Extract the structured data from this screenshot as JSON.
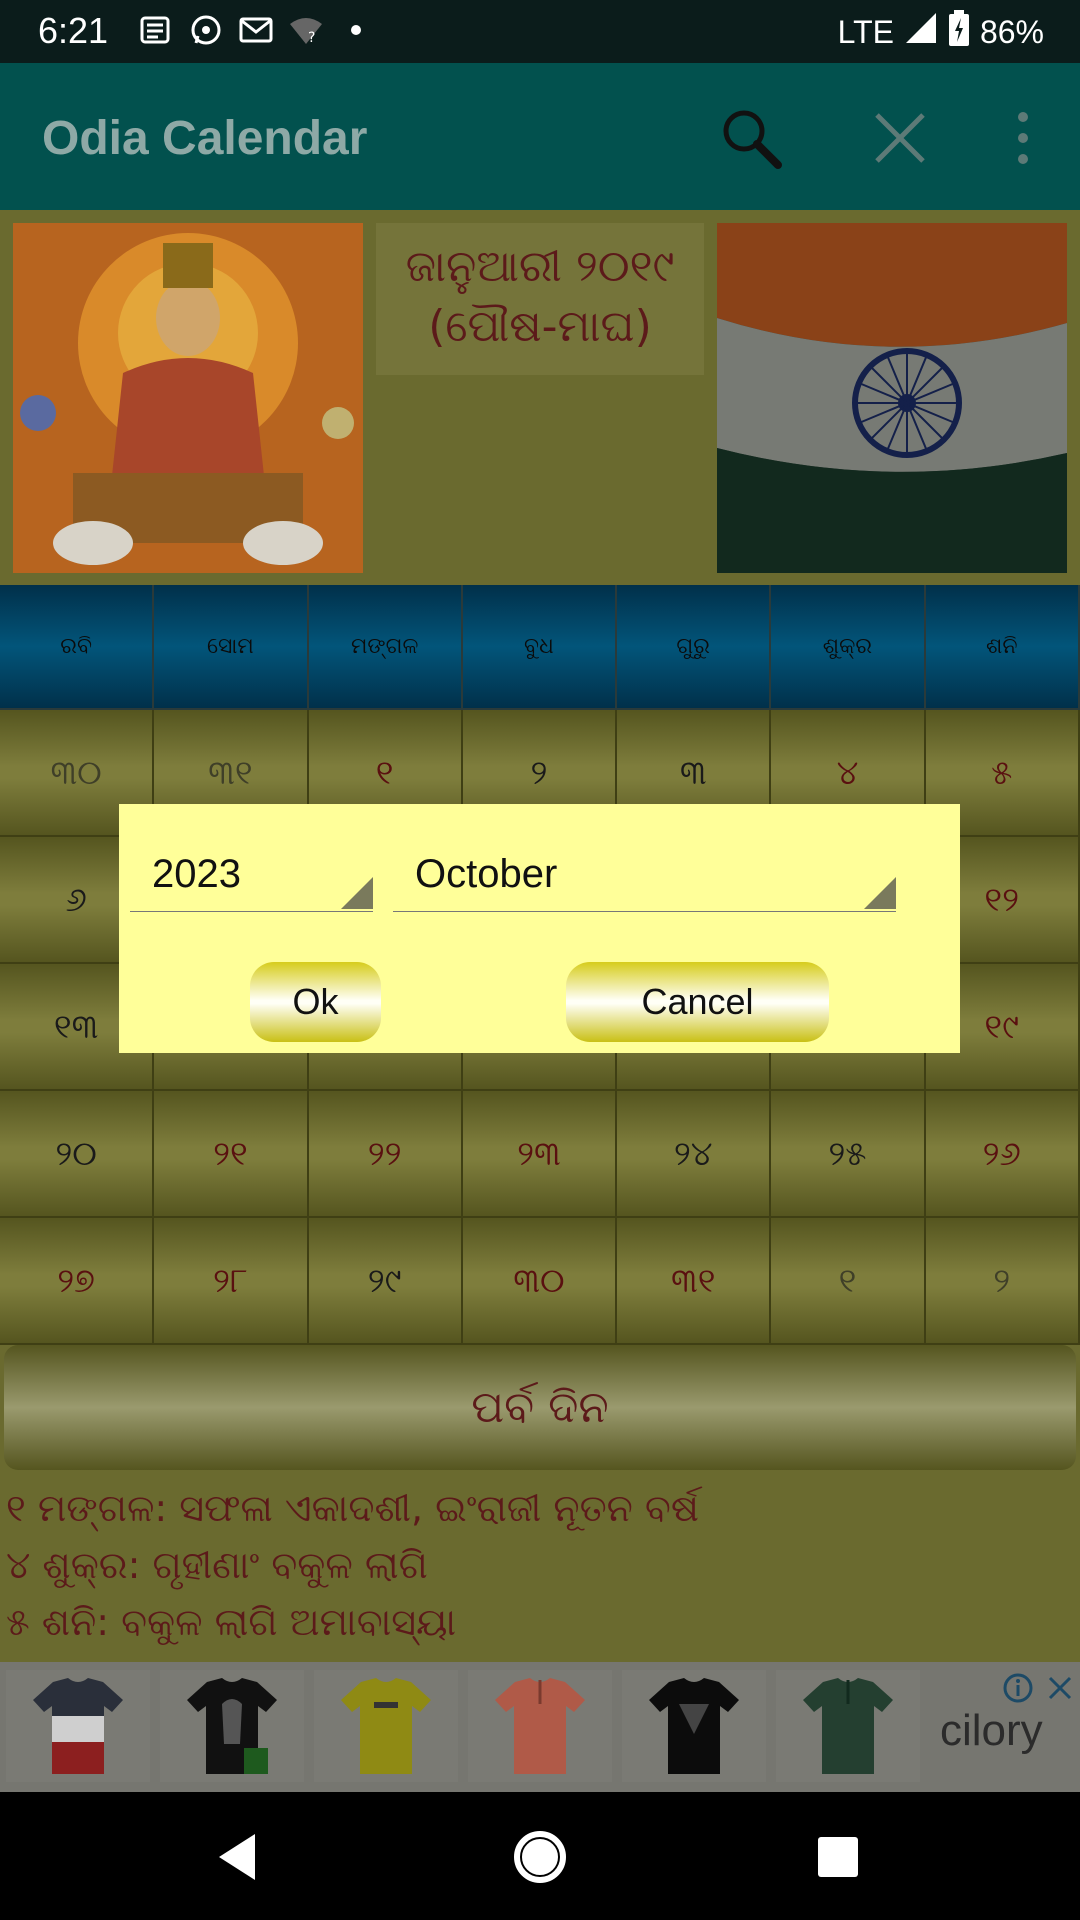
{
  "status_bar": {
    "time": "6:21",
    "network": "LTE",
    "battery": "86%"
  },
  "app_bar": {
    "title": "Odia Calendar"
  },
  "header": {
    "month_line1": "ଜାନୁଆରୀ ୨୦୧୯",
    "month_line2": "(ପୌଷ-ମାଘ)"
  },
  "calendar": {
    "weekdays": [
      "ରବି",
      "ସୋମ",
      "ମଙ୍ଗଳ",
      "ବୁଧ",
      "ଗୁରୁ",
      "ଶୁକ୍ର",
      "ଶନି"
    ],
    "rows": [
      [
        "୩୦",
        "୩୧",
        "୧",
        "୨",
        "୩",
        "୪",
        "୫"
      ],
      [
        "୬",
        "",
        "",
        "",
        "",
        "",
        "୧୨"
      ],
      [
        "୧୩",
        "",
        "",
        "",
        "",
        "",
        "୧୯"
      ],
      [
        "୨୦",
        "୨୧",
        "୨୨",
        "୨୩",
        "୨୪",
        "୨୫",
        "୨୬"
      ],
      [
        "୨୭",
        "୨୮",
        "୨୯",
        "୩୦",
        "୩୧",
        "୧",
        "୨"
      ]
    ]
  },
  "festivals": {
    "title": "ପର୍ବ ଦିନ",
    "items": [
      "୧ ମଙ୍ଗଳ: ସଫଳା ଏକାଦଶୀ, ଇଂରାଜୀ ନୂତନ ବର୍ଷ",
      "୪ ଶୁକ୍ର: ଗୃହୀଣାଂ ବକୁଳ ଲାଗି",
      "୫ ଶନି: ବକୁଳ ଲାଗି ଅମାବାସ୍ୟା"
    ]
  },
  "ad": {
    "brand": "cilory"
  },
  "dialog": {
    "year": "2023",
    "month": "October",
    "ok_label": "Ok",
    "cancel_label": "Cancel"
  }
}
